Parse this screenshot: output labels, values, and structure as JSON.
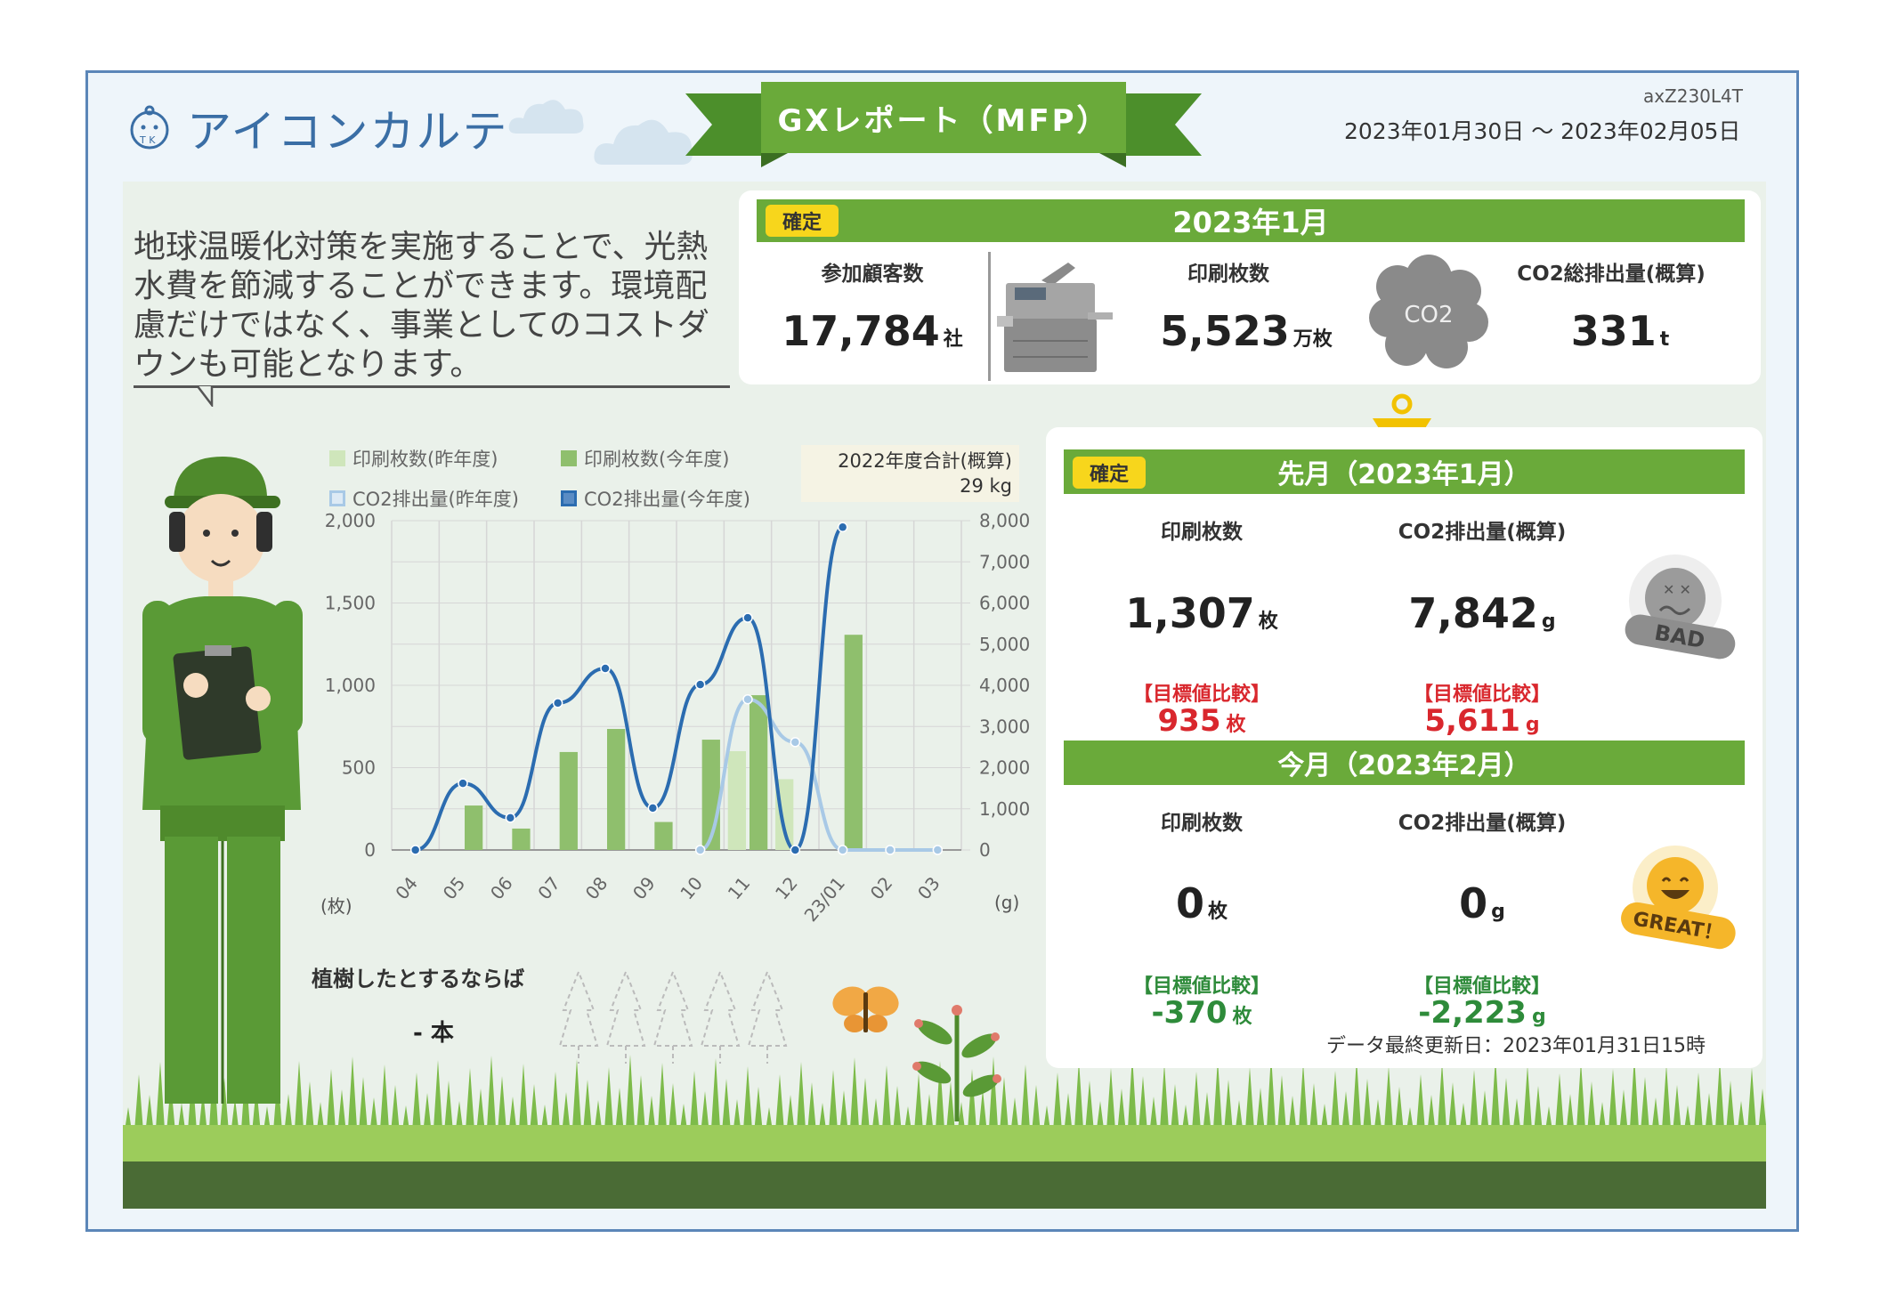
{
  "header": {
    "logo_text": "アイコンカルテ",
    "banner_title": "GXレポート（MFP）",
    "doc_id": "axZ230L4T",
    "period": "2023年01月30日 〜 2023年02月05日"
  },
  "intro": {
    "lines": [
      "地球温暖化対策を実施することで、光熱",
      "水費を節減することができます。環境配",
      "慮だけではなく、事業としてのコストダ",
      "ウンも可能となります。"
    ]
  },
  "summary": {
    "tag": "確定",
    "title": "2023年1月",
    "customers_label": "参加顧客数",
    "customers_value": "17,784",
    "customers_unit": "社",
    "prints_label": "印刷枚数",
    "prints_value": "5,523",
    "prints_unit": "万枚",
    "co2_label": "CO2総排出量(概算)",
    "co2_value": "331",
    "co2_unit": "t",
    "co2_cloud_text": "CO2"
  },
  "last_month": {
    "tag": "確定",
    "title": "先月（2023年1月）",
    "prints_label": "印刷枚数",
    "prints_value": "1,307",
    "prints_unit": "枚",
    "co2_label": "CO2排出量(概算)",
    "co2_value": "7,842",
    "co2_unit": "g",
    "cmp_label": "【目標値比較】",
    "prints_cmp": "935",
    "prints_cmp_unit": "枚",
    "co2_cmp": "5,611",
    "co2_cmp_unit": "g",
    "badge": "BAD",
    "badge_color": "#9b9b9b"
  },
  "this_month": {
    "title": "今月（2023年2月）",
    "prints_label": "印刷枚数",
    "prints_value": "0",
    "prints_unit": "枚",
    "co2_label": "CO2排出量(概算)",
    "co2_value": "0",
    "co2_unit": "g",
    "cmp_label": "【目標値比較】",
    "prints_cmp": "-370",
    "prints_cmp_unit": "枚",
    "co2_cmp": "-2,223",
    "co2_cmp_unit": "g",
    "badge": "GREAT！",
    "badge_color": "#f5b62a"
  },
  "updated": "データ最終更新日：2023年01月31日15時",
  "trees": {
    "question": "植樹したとするならば",
    "answer": "- 本"
  },
  "colors": {
    "accent_green": "#6aaa3a",
    "bar_prev": "#cfe6bb",
    "bar_curr": "#8fbf6d",
    "line_prev": "#a8c9e6",
    "line_curr": "#2b6cb0",
    "red": "#d9272d",
    "green_text": "#2e8b3a"
  },
  "chart_data": {
    "type": "bar",
    "categories": [
      "04",
      "05",
      "06",
      "07",
      "08",
      "09",
      "10",
      "11",
      "12",
      "23/01",
      "02",
      "03"
    ],
    "series": [
      {
        "name": "印刷枚数(昨年度)",
        "type": "bar",
        "axis": "left",
        "values": [
          0,
          0,
          0,
          0,
          0,
          0,
          0,
          600,
          430,
          0,
          0,
          0
        ]
      },
      {
        "name": "印刷枚数(今年度)",
        "type": "bar",
        "axis": "left",
        "values": [
          0,
          270,
          130,
          595,
          735,
          170,
          670,
          940,
          0,
          1307,
          0,
          0
        ]
      },
      {
        "name": "CO2排出量(昨年度)",
        "type": "line",
        "axis": "right",
        "values": [
          null,
          null,
          null,
          null,
          null,
          null,
          0,
          3660,
          2620,
          0,
          0,
          0
        ]
      },
      {
        "name": "CO2排出量(今年度)",
        "type": "line",
        "axis": "right",
        "values": [
          0,
          1620,
          780,
          3570,
          4410,
          1020,
          4020,
          5640,
          0,
          7842,
          null,
          null
        ]
      }
    ],
    "ylim_left": [
      0,
      2000
    ],
    "yticks_left": [
      "0",
      "500",
      "1,000",
      "1,500",
      "2,000"
    ],
    "ylim_right": [
      0,
      8000
    ],
    "yticks_right": [
      "0",
      "1,000",
      "2,000",
      "3,000",
      "4,000",
      "5,000",
      "6,000",
      "7,000",
      "8,000"
    ],
    "ylabel_left": "(枚)",
    "ylabel_right": "(g)",
    "total_label": "2022年度合計(概算)",
    "total_value": "29 kg",
    "grid": true,
    "legend_position": "top"
  }
}
